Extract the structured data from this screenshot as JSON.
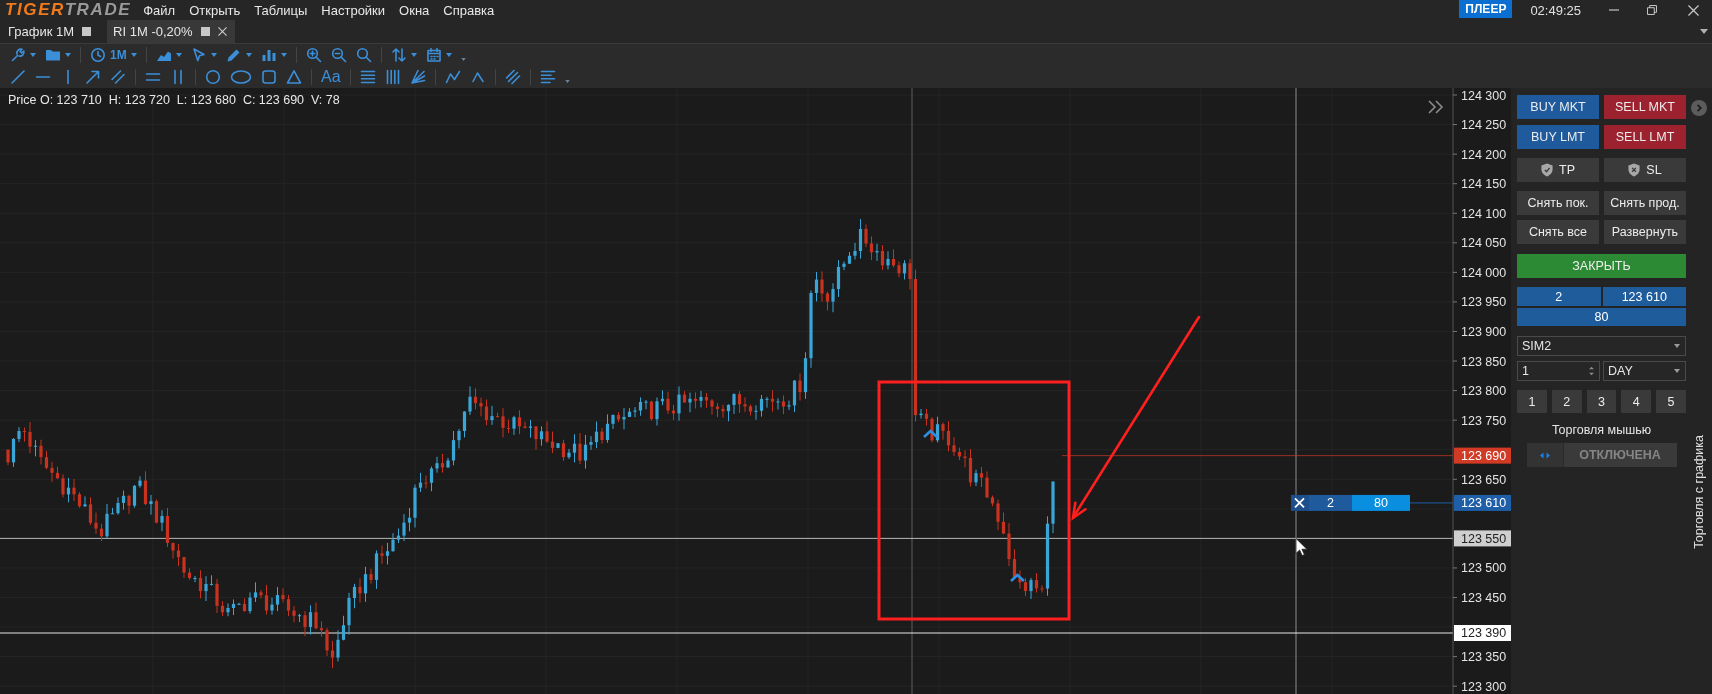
{
  "title_bar": {
    "logo": [
      "TIGER",
      "TRADE"
    ],
    "menu": [
      "Файл",
      "Открыть",
      "Таблицы",
      "Настройки",
      "Окна",
      "Справка"
    ],
    "mode_badge": "ПЛЕЕР",
    "clock": "02:49:25"
  },
  "tabs": [
    {
      "label": "График 1M",
      "selected": false
    },
    {
      "label": "RI 1M -0,20%",
      "selected": true
    }
  ],
  "toolbar": {
    "timeframe": "1M",
    "text_tool": "Aa"
  },
  "chart": {
    "price_info": "Price O: 123 710  H: 123 720  L: 123 680  C: 123 690  V: 78",
    "order_marker": {
      "quantity": "2",
      "value": "80"
    },
    "price_axis": {
      "ticks": [
        "124 300",
        "124 250",
        "124 200",
        "124 150",
        "124 100",
        "124 050",
        "124 000",
        "123 950",
        "123 900",
        "123 850",
        "123 800",
        "123 750",
        "123 650",
        "123 500",
        "123 450",
        "123 350",
        "123 300"
      ],
      "markers": [
        {
          "kind": "last",
          "price": "123 690",
          "color": "#d13b26"
        },
        {
          "kind": "order",
          "price": "123 610",
          "color": "#1e5fa8"
        },
        {
          "kind": "crosshair",
          "price": "123 550",
          "color": "#cfcfcf"
        },
        {
          "kind": "level",
          "price": "123 390",
          "color": "#ffffff"
        }
      ]
    }
  },
  "trade_panel": {
    "order_buttons": [
      {
        "label": "BUY MKT",
        "kind": "buy"
      },
      {
        "label": "SELL MKT",
        "kind": "sell"
      },
      {
        "label": "BUY LMT",
        "kind": "buy"
      },
      {
        "label": "SELL LMT",
        "kind": "sell"
      }
    ],
    "protect_buttons": [
      {
        "label": "TP",
        "kind": "take_profit"
      },
      {
        "label": "SL",
        "kind": "stop_loss"
      }
    ],
    "action_buttons": [
      "Снять пок.",
      "Снять прод.",
      "Снять все",
      "Развернуть"
    ],
    "close_button": "ЗАКРЫТЬ",
    "position": {
      "quantity": "2",
      "price": "123 610",
      "pnl": "80"
    },
    "account": "SIM2",
    "quantity": "1",
    "time_in_force": "DAY",
    "presets": [
      "1",
      "2",
      "3",
      "4",
      "5"
    ],
    "mouse_trading": {
      "label": "Торговля мышью",
      "status": "ОТКЛЮЧЕНА",
      "on": false
    },
    "side_tab": "Торговля с графика"
  }
}
